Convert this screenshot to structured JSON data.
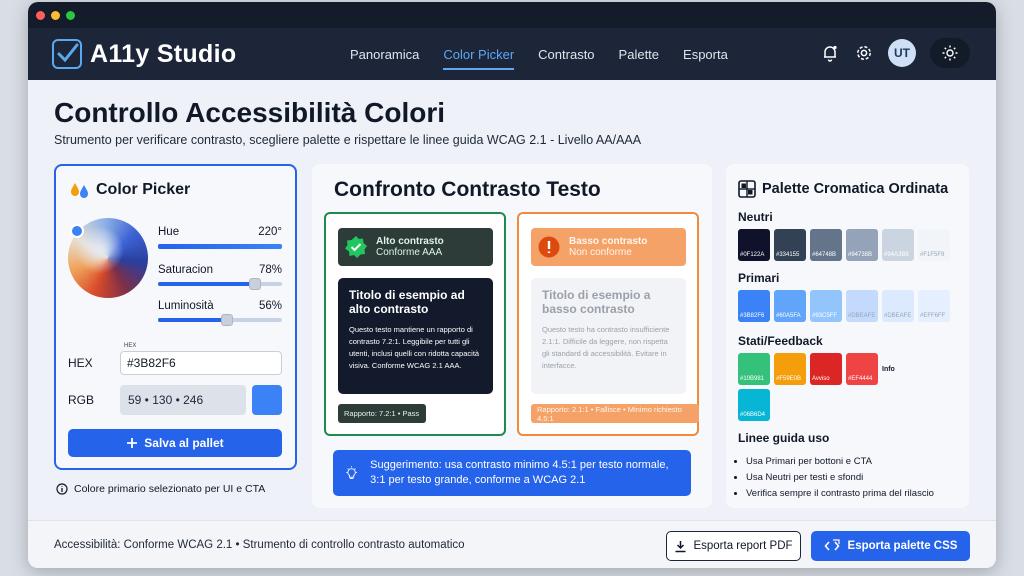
{
  "app": {
    "title": "A11y Studio",
    "accent": "#2563eb"
  },
  "nav": [
    {
      "label": "Panoramica"
    },
    {
      "label": "Color Picker",
      "active": true
    },
    {
      "label": "Contrasto"
    },
    {
      "label": "Palette"
    },
    {
      "label": "Esporta"
    }
  ],
  "header": {
    "avatar": "UT"
  },
  "page": {
    "title": "Controllo Accessibilità Colori",
    "subtitle": "Strumento per verificare contrasto, scegliere palette e rispettare le linee guida WCAG 2.1 - Livello AA/AAA"
  },
  "picker": {
    "title": "Color Picker",
    "hue": {
      "label": "Hue",
      "value": "220°",
      "level": 1.0
    },
    "saturation": {
      "label": "Saturacion",
      "value": "78%",
      "level": 0.78
    },
    "luminosity": {
      "label": "Luminosità",
      "value": "56%",
      "level": 0.56
    },
    "hex_caption": "HEX",
    "hex_label": "HEX",
    "hex_value": "#3B82F6",
    "rgb_label": "RGB",
    "rgb_value": "59 • 130 • 246",
    "swatch_color": "#3b82f6",
    "save_label": "Salva al pallet",
    "info": "Colore primario selezionato per UI e CTA"
  },
  "contrast": {
    "title": "Confronto Contrasto Testo",
    "good": {
      "status_title": "Alto contrasto",
      "status_sub": "Conforme AAA",
      "sample_title": "Titolo di esempio ad alto contrasto",
      "sample_body": "Questo testo mantiene un rapporto di contrasto 7.2:1. Leggibile per tutti gli utenti, inclusi quelli con ridotta capacità visiva. Conforme WCAG 2.1 AAA.",
      "ratio": "Rapporto: 7.2:1 • Pass",
      "color": "#1f8a4d"
    },
    "bad": {
      "status_title": "Basso contrasto",
      "status_sub": "Non conforme",
      "sample_title": "Titolo di esempio a basso contrasto",
      "sample_body": "Questo testo ha contrasto insufficiente 2.1:1. Difficile da leggere, non rispetta gli standard di accessibilità. Evitare in interfacce.",
      "ratio": "Rapporto: 2.1:1 • Fallisce • Minimo richiesto 4.5:1",
      "color": "#f08a3e"
    },
    "tip": "Suggerimento: usa contrasto minimo 4.5:1 per testo normale, 3:1 per testo grande, conforme a WCAG 2.1"
  },
  "palette": {
    "title": "Palette Cromatica Ordinata",
    "groups": {
      "neutri": {
        "label": "Neutri",
        "swatches": [
          {
            "hex": "#0F122A",
            "color": "#0f122a"
          },
          {
            "hex": "#334155",
            "color": "#334155"
          },
          {
            "hex": "#64748B",
            "color": "#64748b"
          },
          {
            "hex": "#94738B",
            "color": "#94a3b8"
          },
          {
            "hex": "#94A3B8",
            "color": "#cbd5e1"
          },
          {
            "hex": "#F1F5F9",
            "color": "#f1f5f9",
            "light": true
          }
        ]
      },
      "primari": {
        "label": "Primari",
        "swatches": [
          {
            "hex": "#3B82F6",
            "color": "#3b82f6"
          },
          {
            "hex": "#60A5FA",
            "color": "#60a5fa"
          },
          {
            "hex": "#93C5FF",
            "color": "#93c5fd"
          },
          {
            "hex": "#DBEAFE",
            "color": "#c3dafd",
            "light": true
          },
          {
            "hex": "#DBEAFE",
            "color": "#dbeafe",
            "light": true
          },
          {
            "hex": "#EFF6FF",
            "color": "#e5efff",
            "light": true
          }
        ]
      },
      "stati": {
        "label": "Stati/Feedback",
        "swatches": [
          {
            "hex": "#10B981",
            "color": "#34c17a"
          },
          {
            "hex": "#F59E0B",
            "color": "#f59e0b"
          },
          {
            "hex": "Avviso",
            "color": "#dc2626"
          },
          {
            "hex": "#EF4444",
            "color": "#ef4444"
          }
        ],
        "info_label": "Info",
        "extra": {
          "hex": "#06B6D4",
          "color": "#06b6d4"
        }
      }
    },
    "guides_title": "Linee guida uso",
    "guides": [
      "Usa Primari per bottoni e CTA",
      "Usa Neutri per testi e sfondi",
      "Verifica sempre il contrasto prima del rilascio"
    ]
  },
  "footer": {
    "text": "Accessibilità: Conforme WCAG 2.1  •  Strumento di controllo contrasto automatico",
    "export_pdf": "Esporta report PDF",
    "export_css": "Esporta palette CSS"
  }
}
